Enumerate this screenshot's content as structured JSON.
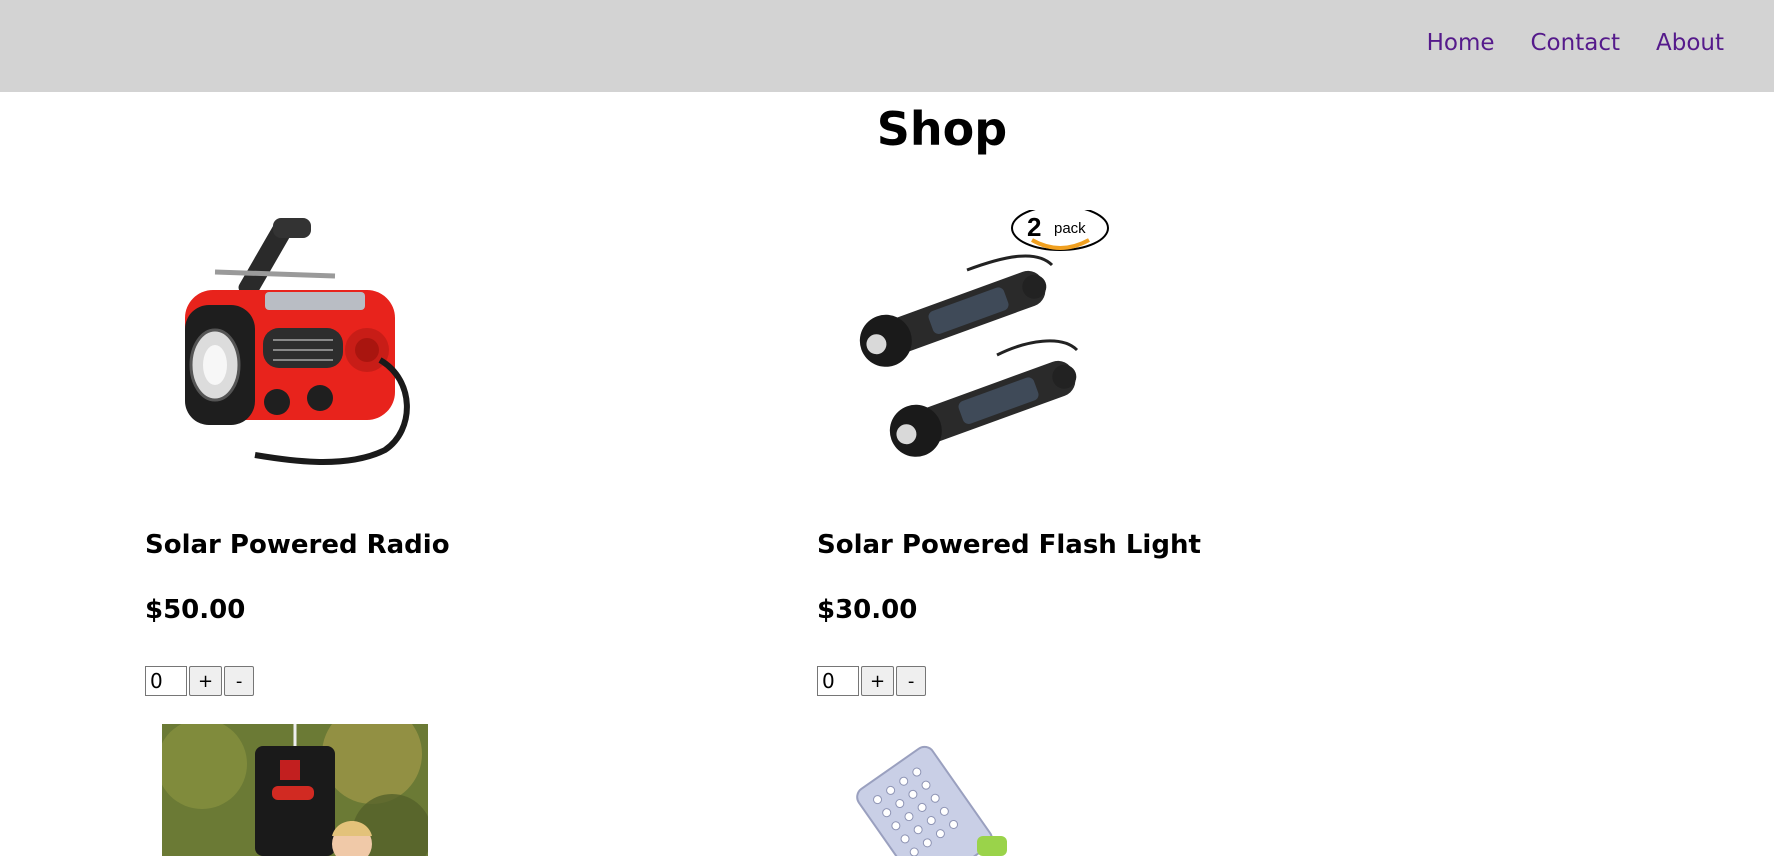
{
  "nav": {
    "links": [
      "Home",
      "Contact",
      "About"
    ]
  },
  "page": {
    "title": "Shop"
  },
  "products": [
    {
      "name": "Solar Powered Radio",
      "price": "$50.00",
      "quantity": "0",
      "plus": "+",
      "minus": "-"
    },
    {
      "name": "Solar Powered Flash Light",
      "price": "$30.00",
      "quantity": "0",
      "plus": "+",
      "minus": "-"
    }
  ],
  "badges": {
    "pack_number": "2",
    "pack_word": "pack"
  },
  "colors": {
    "navbar_bg": "#d3d3d3",
    "link": "#551a8b",
    "radio_red": "#e8231c"
  }
}
